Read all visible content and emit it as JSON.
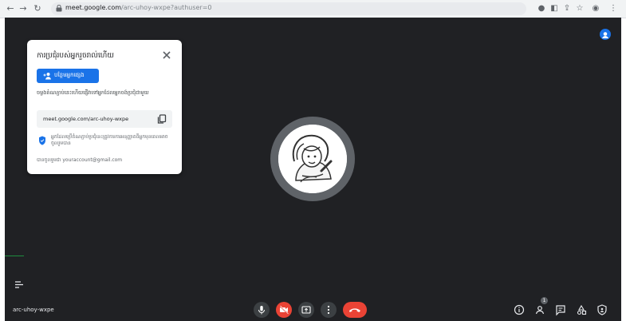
{
  "browser": {
    "url_host": "meet.google.com",
    "url_path": "/arc-uhoy-wxpe?authuser=0"
  },
  "meeting_panel": {
    "title": "ការប្រជុំរបស់អ្នករួចរាល់ហើយ",
    "add_button_label": "បន្ថែមអ្នកផ្សេង",
    "description": "ចម្លងតំណភ្ជាប់នេះហើយផ្ញើវាទៅអ្នកដែលអ្នកចង់ប្រជុំជាមួយ",
    "meeting_link": "meet.google.com/arc-uhoy-wxpe",
    "security_note": "អ្នកដែលប្រើតំណភ្ជាប់ប្រជុំនេះត្រូវការការអនុញ្ញាតពីអ្នកមុនពេលអាចចូលរួមបាន",
    "joined_as": "បានចូលរួមជា youraccount@gmail.com"
  },
  "footer": {
    "meeting_code": "arc-uhoy-wxpe",
    "participants_count": "1"
  },
  "colors": {
    "stage_bg": "#202124",
    "accent": "#1a73e8",
    "danger": "#ea4335",
    "control_bg": "#3c4043"
  }
}
